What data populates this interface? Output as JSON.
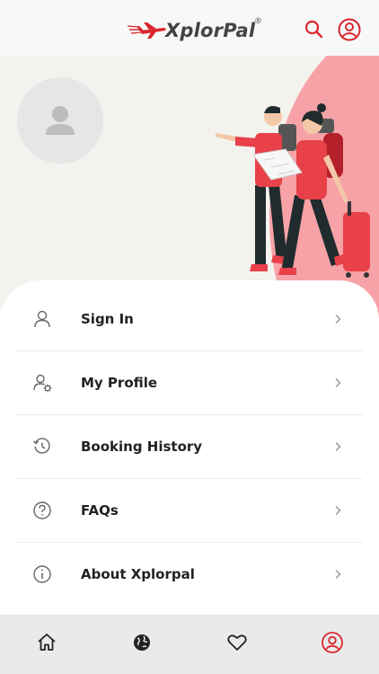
{
  "header": {
    "brand": "XplorPal",
    "brand_mark": "®",
    "brand_color": "#d9262f",
    "icons": [
      "search-icon",
      "account-icon"
    ]
  },
  "hero": {
    "avatar_icon": "user-placeholder-icon",
    "illustration": "travelers-couple-illustration",
    "blob_color": "#f6a2a6"
  },
  "menu": {
    "items": [
      {
        "label": "Sign In",
        "icon": "user-icon"
      },
      {
        "label": "My Profile",
        "icon": "user-settings-icon"
      },
      {
        "label": "Booking History",
        "icon": "history-icon"
      },
      {
        "label": "FAQs",
        "icon": "question-icon"
      },
      {
        "label": "About Xplorpal",
        "icon": "info-icon"
      }
    ]
  },
  "tabbar": {
    "tabs": [
      {
        "icon": "home-icon",
        "active": false
      },
      {
        "icon": "globe-icon",
        "active": false
      },
      {
        "icon": "heart-icon",
        "active": false
      },
      {
        "icon": "profile-icon",
        "active": true
      }
    ],
    "active_color": "#d9262f"
  }
}
